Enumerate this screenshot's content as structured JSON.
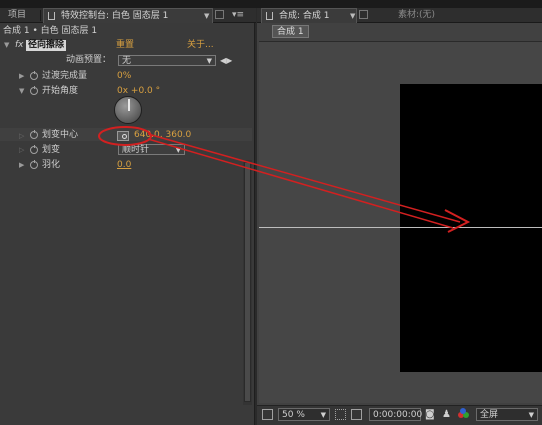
{
  "tabs": {
    "project": "项目",
    "effect_controls": "特效控制台: 白色 固态层 1",
    "composition": "合成: 合成 1",
    "footage": "素材:(无)"
  },
  "breadcrumb": "合成 1 • 白色 固态层 1",
  "effect": {
    "fx": "fx",
    "name": "径向擦除",
    "reset": "重置",
    "about": "关于..."
  },
  "properties": {
    "preset_label": "动画预置：",
    "preset_value": "无",
    "transition_label": "过渡完成量",
    "transition_value": "0%",
    "start_angle_label": "开始角度",
    "start_angle_value": "0x +0.0 °",
    "wipe_center_label": "划变中心",
    "wipe_center_value": "640.0, 360.0",
    "wipe_label": "划变",
    "wipe_value": "顺时针",
    "feather_label": "羽化",
    "feather_value": "0.0"
  },
  "comp_button": "合成 1",
  "viewer_bar": {
    "zoom": "50 %",
    "timecode": "0:00:00:00",
    "resolution": "全屏"
  },
  "icons": [
    "menu-icon",
    "lock-icon",
    "stopwatch-icon",
    "disclosure-triangle-icon",
    "point-control-icon",
    "camera-icon",
    "color-channels-icon",
    "grid-icon",
    "region-of-interest-icon"
  ],
  "colors": {
    "value_accent": "#d8a040",
    "annotation": "#d22020"
  }
}
